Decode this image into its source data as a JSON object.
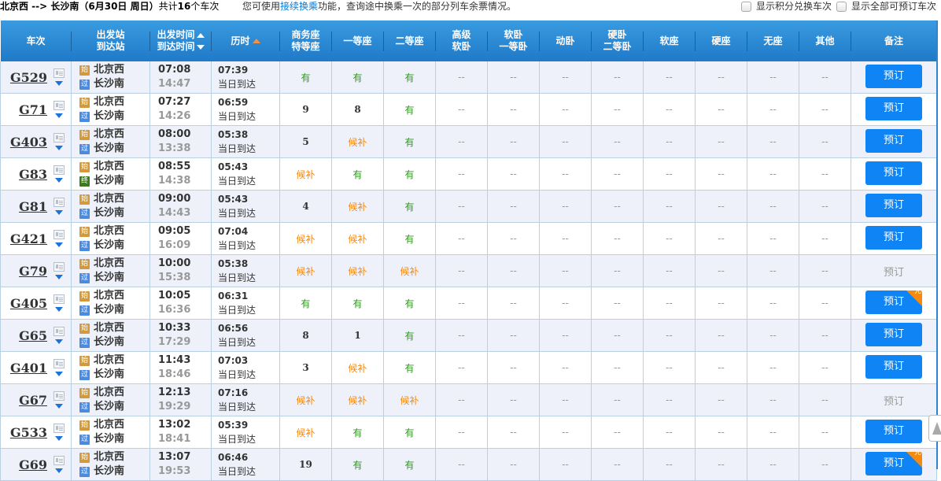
{
  "topbar": {
    "route": "北京西 --> 长沙南（6月30日  周日）",
    "count_prefix": "共计",
    "count": "16",
    "count_suffix": "个车次",
    "hint_prefix": "您可使用",
    "hint_link": "接续换乘",
    "hint_suffix": "功能，查询途中换乘一次的部分列车余票情况。",
    "option1": "显示积分兑换车次",
    "option2": "显示全部可预订车次"
  },
  "header": {
    "train": "车次",
    "station_from": "出发站",
    "station_to": "到达站",
    "time_dep": "出发时间",
    "time_arr": "到达时间",
    "duration": "历时",
    "biz_1": "商务座",
    "biz_2": "特等座",
    "first": "一等座",
    "second": "二等座",
    "hsoft_1": "高级",
    "hsoft_2": "软卧",
    "soft_1": "软卧",
    "soft_2": "一等卧",
    "dong": "动卧",
    "hard_1": "硬卧",
    "hard_2": "二等卧",
    "softseat": "软座",
    "hardseat": "硬座",
    "noseat": "无座",
    "other": "其他",
    "remark": "备注"
  },
  "tags": {
    "start": "始",
    "pass": "过",
    "end": "终"
  },
  "same_day": "当日到达",
  "book_label": "预订",
  "dui_label": "兑",
  "rows": [
    {
      "no": "G529",
      "from": "北京西",
      "to": "长沙南",
      "to_tag": "pass",
      "dep": "07:08",
      "arr": "14:47",
      "dur": "07:39",
      "biz": "有",
      "first": "有",
      "second": "有",
      "book": "active",
      "dui": false
    },
    {
      "no": "G71",
      "from": "北京西",
      "to": "长沙南",
      "to_tag": "pass",
      "dep": "07:27",
      "arr": "14:26",
      "dur": "06:59",
      "biz": "9",
      "first": "8",
      "second": "有",
      "book": "active",
      "dui": false
    },
    {
      "no": "G403",
      "from": "北京西",
      "to": "长沙南",
      "to_tag": "pass",
      "dep": "08:00",
      "arr": "13:38",
      "dur": "05:38",
      "biz": "5",
      "first": "候补",
      "second": "有",
      "book": "active",
      "dui": false
    },
    {
      "no": "G83",
      "from": "北京西",
      "to": "长沙南",
      "to_tag": "end",
      "dep": "08:55",
      "arr": "14:38",
      "dur": "05:43",
      "biz": "候补",
      "first": "有",
      "second": "有",
      "book": "active",
      "dui": false
    },
    {
      "no": "G81",
      "from": "北京西",
      "to": "长沙南",
      "to_tag": "pass",
      "dep": "09:00",
      "arr": "14:43",
      "dur": "05:43",
      "biz": "4",
      "first": "候补",
      "second": "有",
      "book": "active",
      "dui": false
    },
    {
      "no": "G421",
      "from": "北京西",
      "to": "长沙南",
      "to_tag": "pass",
      "dep": "09:05",
      "arr": "16:09",
      "dur": "07:04",
      "biz": "候补",
      "first": "候补",
      "second": "有",
      "book": "active",
      "dui": false
    },
    {
      "no": "G79",
      "from": "北京西",
      "to": "长沙南",
      "to_tag": "pass",
      "dep": "10:00",
      "arr": "15:38",
      "dur": "05:38",
      "biz": "候补",
      "first": "候补",
      "second": "候补",
      "book": "disabled",
      "dui": false
    },
    {
      "no": "G405",
      "from": "北京西",
      "to": "长沙南",
      "to_tag": "pass",
      "dep": "10:05",
      "arr": "16:36",
      "dur": "06:31",
      "biz": "有",
      "first": "有",
      "second": "有",
      "book": "active",
      "dui": true
    },
    {
      "no": "G65",
      "from": "北京西",
      "to": "长沙南",
      "to_tag": "pass",
      "dep": "10:33",
      "arr": "17:29",
      "dur": "06:56",
      "biz": "8",
      "first": "1",
      "second": "有",
      "book": "active",
      "dui": false
    },
    {
      "no": "G401",
      "from": "北京西",
      "to": "长沙南",
      "to_tag": "pass",
      "dep": "11:43",
      "arr": "18:46",
      "dur": "07:03",
      "biz": "3",
      "first": "候补",
      "second": "有",
      "book": "active",
      "dui": false
    },
    {
      "no": "G67",
      "from": "北京西",
      "to": "长沙南",
      "to_tag": "pass",
      "dep": "12:13",
      "arr": "19:29",
      "dur": "07:16",
      "biz": "候补",
      "first": "候补",
      "second": "候补",
      "book": "disabled",
      "dui": false
    },
    {
      "no": "G533",
      "from": "北京西",
      "to": "长沙南",
      "to_tag": "pass",
      "dep": "13:02",
      "arr": "18:41",
      "dur": "05:39",
      "biz": "候补",
      "first": "有",
      "second": "有",
      "book": "active",
      "dui": false
    },
    {
      "no": "G69",
      "from": "北京西",
      "to": "长沙南",
      "to_tag": "pass",
      "dep": "13:07",
      "arr": "19:53",
      "dur": "06:46",
      "biz": "19",
      "first": "有",
      "second": "有",
      "book": "active",
      "dui": true
    }
  ],
  "empty_seat": "--",
  "colors": {
    "header_blue": "#1f7ac8",
    "book_blue": "#0f85f5",
    "have_green": "#2a9c16",
    "wait_orange": "#f7890f"
  }
}
